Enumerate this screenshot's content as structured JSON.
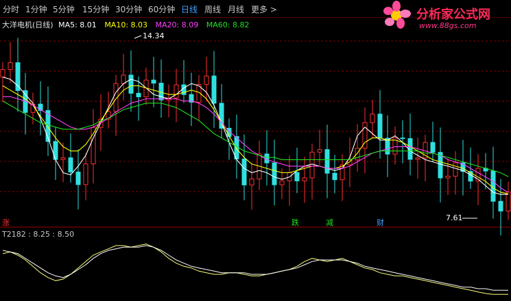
{
  "toolbar": {
    "periods": [
      "分时",
      "1分钟",
      "5分钟",
      "15分钟",
      "30分钟",
      "60分钟",
      "日线",
      "周线",
      "月线"
    ],
    "active": "日线",
    "more": "更多 >"
  },
  "logo": {
    "text": "分析家公式网",
    "url": "www.88gs.com"
  },
  "legend": {
    "stock": "大洋电机(日线)",
    "ma": [
      {
        "label": "MA5: 8.01",
        "color": "#ffffff"
      },
      {
        "label": "MA10: 8.03",
        "color": "#ffff00"
      },
      {
        "label": "MA20: 8.09",
        "color": "#ff40ff"
      },
      {
        "label": "MA60: 8.82",
        "color": "#20e020"
      }
    ]
  },
  "colors": {
    "up": "#ff3030",
    "down": "#30e0e0",
    "grid": "#8b0000",
    "ma5": "#ffffff",
    "ma10": "#ffff00",
    "ma20": "#ff40ff",
    "ma60": "#20e020",
    "ind1": "#ffff80",
    "ind2": "#ffffff"
  },
  "chart_data": [
    {
      "type": "line",
      "series": [
        {
          "name": "MA5",
          "y": [
            13.4,
            13.3,
            13.0,
            12.6,
            12.2,
            11.5,
            10.6,
            9.6,
            9.0,
            8.9,
            9.3,
            9.8,
            10.6,
            11.3,
            12.0,
            12.7,
            13.1,
            13.3,
            13.2,
            12.9,
            12.6,
            12.5,
            12.4,
            12.6,
            12.9,
            13.1,
            13.0,
            12.7,
            12.1,
            11.3,
            10.4,
            9.6,
            9.2,
            9.0,
            9.1,
            9.0,
            8.8,
            8.7,
            8.8,
            9.1,
            9.3,
            9.4,
            9.3,
            9.2,
            9.1,
            9.2,
            9.7,
            10.7,
            11.1,
            10.8,
            10.5,
            10.5,
            10.7,
            10.4,
            10.0,
            9.8,
            9.6,
            9.5,
            9.4,
            9.3,
            9.2,
            9.1,
            8.9,
            8.7,
            8.4,
            8.1,
            8.0,
            8.0
          ]
        },
        {
          "name": "MA10",
          "y": [
            13.0,
            12.8,
            12.6,
            12.4,
            12.1,
            11.6,
            11.1,
            10.6,
            10.2,
            10.0,
            10.0,
            10.3,
            10.8,
            11.4,
            11.9,
            12.4,
            12.8,
            13.0,
            13.0,
            12.9,
            12.8,
            12.7,
            12.6,
            12.6,
            12.7,
            12.8,
            12.7,
            12.4,
            11.9,
            11.3,
            10.7,
            10.1,
            9.7,
            9.4,
            9.3,
            9.2,
            9.1,
            9.0,
            9.0,
            9.1,
            9.2,
            9.3,
            9.3,
            9.2,
            9.2,
            9.3,
            9.5,
            9.9,
            10.4,
            10.6,
            10.6,
            10.5,
            10.5,
            10.4,
            10.2,
            10.0,
            9.8,
            9.6,
            9.5,
            9.4,
            9.3,
            9.2,
            9.0,
            8.8,
            8.6,
            8.3,
            8.1,
            8.03
          ]
        },
        {
          "name": "MA20",
          "y": [
            12.5,
            12.5,
            12.4,
            12.3,
            12.1,
            11.9,
            11.7,
            11.5,
            11.3,
            11.1,
            11.0,
            11.0,
            11.1,
            11.3,
            11.5,
            11.8,
            12.0,
            12.2,
            12.3,
            12.4,
            12.4,
            12.4,
            12.4,
            12.4,
            12.3,
            12.3,
            12.2,
            12.0,
            11.7,
            11.3,
            10.9,
            10.6,
            10.3,
            10.0,
            9.8,
            9.6,
            9.5,
            9.4,
            9.3,
            9.3,
            9.3,
            9.3,
            9.3,
            9.2,
            9.2,
            9.2,
            9.3,
            9.5,
            9.7,
            9.9,
            10.0,
            10.1,
            10.2,
            10.2,
            10.2,
            10.1,
            10.0,
            9.9,
            9.8,
            9.6,
            9.5,
            9.4,
            9.2,
            9.0,
            8.8,
            8.6,
            8.3,
            8.09
          ]
        },
        {
          "name": "MA60",
          "y": [
            12.3,
            12.1,
            11.9,
            11.7,
            11.5,
            11.3,
            11.2,
            11.1,
            11.0,
            11.0,
            11.0,
            11.1,
            11.2,
            11.4,
            11.5,
            11.7,
            11.9,
            12.0,
            12.1,
            12.2,
            12.2,
            12.2,
            12.1,
            12.0,
            11.8,
            11.6,
            11.4,
            11.1,
            10.8,
            10.6,
            10.4,
            10.2,
            10.0,
            9.9,
            9.8,
            9.7,
            9.7,
            9.6,
            9.6,
            9.6,
            9.6,
            9.6,
            9.6,
            9.6,
            9.6,
            9.6,
            9.6,
            9.7,
            9.8,
            9.9,
            10.0,
            10.0,
            10.0,
            10.0,
            10.0,
            10.0,
            9.9,
            9.9,
            9.8,
            9.7,
            9.6,
            9.5,
            9.4,
            9.3,
            9.2,
            9.1,
            9.0,
            8.82
          ]
        }
      ],
      "annotations": [
        {
          "label": "14.34"
        },
        {
          "label": "7.61"
        }
      ],
      "markers": [
        {
          "label": "涨",
          "color": "#ff3030"
        },
        {
          "label": "跌",
          "color": "#20e020"
        },
        {
          "label": "减",
          "color": "#20e020"
        },
        {
          "label": "财",
          "color": "#3fa0ff"
        }
      ],
      "ylim": [
        7.0,
        15.5
      ],
      "grid": true
    },
    {
      "type": "line",
      "legend": "T2182 : 8.25 : 8.50",
      "series": [
        {
          "y": [
            10.8,
            10.9,
            10.7,
            10.4,
            10.0,
            9.6,
            9.3,
            9.1,
            9.2,
            9.5,
            9.9,
            10.3,
            10.7,
            10.9,
            11.1,
            11.3,
            11.3,
            11.2,
            11.3,
            11.4,
            11.2,
            10.9,
            10.5,
            10.2,
            10.0,
            9.9,
            9.7,
            9.6,
            9.5,
            9.5,
            9.6,
            9.6,
            9.5,
            9.4,
            9.4,
            9.5,
            9.6,
            9.7,
            9.8,
            10.0,
            10.3,
            10.5,
            10.4,
            10.3,
            10.4,
            10.5,
            10.3,
            10.1,
            9.9,
            9.8,
            9.6,
            9.5,
            9.4,
            9.4,
            9.3,
            9.2,
            9.1,
            9.0,
            8.9,
            8.8,
            8.7,
            8.6,
            8.5,
            8.4,
            8.3,
            8.25,
            8.25,
            8.25
          ]
        },
        {
          "y": [
            11.0,
            10.9,
            10.8,
            10.5,
            10.2,
            9.9,
            9.6,
            9.4,
            9.3,
            9.5,
            9.8,
            10.1,
            10.5,
            10.8,
            11.0,
            11.1,
            11.2,
            11.2,
            11.2,
            11.3,
            11.2,
            11.0,
            10.7,
            10.4,
            10.2,
            10.0,
            9.9,
            9.8,
            9.7,
            9.6,
            9.6,
            9.6,
            9.6,
            9.5,
            9.5,
            9.5,
            9.6,
            9.7,
            9.8,
            9.9,
            10.1,
            10.3,
            10.4,
            10.4,
            10.4,
            10.4,
            10.3,
            10.2,
            10.0,
            9.9,
            9.8,
            9.7,
            9.6,
            9.5,
            9.4,
            9.3,
            9.2,
            9.1,
            9.0,
            8.9,
            8.8,
            8.7,
            8.7,
            8.6,
            8.6,
            8.5,
            8.5,
            8.5
          ]
        }
      ],
      "ylim": [
        8.0,
        11.6
      ]
    }
  ]
}
